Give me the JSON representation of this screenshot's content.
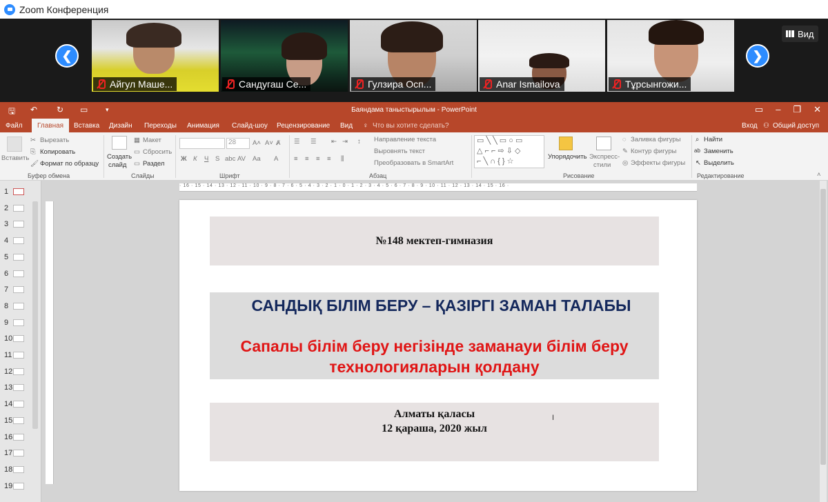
{
  "zoom": {
    "title": "Zoom Конференция",
    "view_label": "Вид",
    "participants": [
      {
        "name": "Айгул Маше..."
      },
      {
        "name": "Сандугаш Се..."
      },
      {
        "name": "Гулзира Осп..."
      },
      {
        "name": "Anar Ismailova"
      },
      {
        "name": "Тұрсынгожи..."
      }
    ]
  },
  "ppt": {
    "doc_title": "Баяндама таныстырылым - PowerPoint",
    "tabs": [
      "Файл",
      "Главная",
      "Вставка",
      "Дизайн",
      "Переходы",
      "Анимация",
      "Слайд-шоу",
      "Рецензирование",
      "Вид"
    ],
    "tell_me": "Что вы хотите сделать?",
    "signin": "Вход",
    "share": "Общий доступ",
    "ribbon": {
      "paste": "Вставить",
      "cut": "Вырезать",
      "copy": "Копировать",
      "format_painter": "Формат по образцу",
      "clipboard_group": "Буфер обмена",
      "new_slide_1": "Создать",
      "new_slide_2": "слайд",
      "layout": "Макет",
      "reset": "Сбросить",
      "section": "Раздел",
      "slides_group": "Слайды",
      "font_size": "28",
      "font_group": "Шрифт",
      "text_direction": "Направление текста",
      "align_text": "Выровнять текст",
      "smartart": "Преобразовать в SmartArt",
      "paragraph_group": "Абзац",
      "arrange": "Упорядочить",
      "quick_styles_1": "Экспресс-",
      "quick_styles_2": "стили",
      "shape_fill": "Заливка фигуры",
      "shape_outline": "Контур фигуры",
      "shape_effects": "Эффекты фигуры",
      "drawing_group": "Рисование",
      "find": "Найти",
      "replace": "Заменить",
      "select": "Выделить",
      "editing_group": "Редактирование"
    },
    "ruler_text": "· 16 · 15 · 14 · 13 · 12 · 11 · 10 · 9 · 8 · 7 · 6 · 5 · 4 · 3 · 2 · 1 · 0 · 1 · 2 · 3 · 4 · 5 · 6 · 7 · 8 · 9 · 10 · 11 · 12 · 13 · 14 · 15 · 16 ·",
    "slide_numbers": [
      "1",
      "2",
      "3",
      "4",
      "5",
      "6",
      "7",
      "8",
      "9",
      "10",
      "11",
      "12",
      "13",
      "14",
      "15",
      "16",
      "17",
      "18",
      "19"
    ],
    "slide": {
      "school": "№148 мектеп-гимназия",
      "title": "САНДЫҚ БІЛІМ БЕРУ – ҚАЗІРГІ ЗАМАН ТАЛАБЫ",
      "subtitle_line1": "Сапалы білім беру негізінде заманауи білім беру",
      "subtitle_line2": "технологияларын қолдану",
      "city": "Алматы қаласы",
      "date": "12 қараша, 2020 жыл"
    }
  }
}
